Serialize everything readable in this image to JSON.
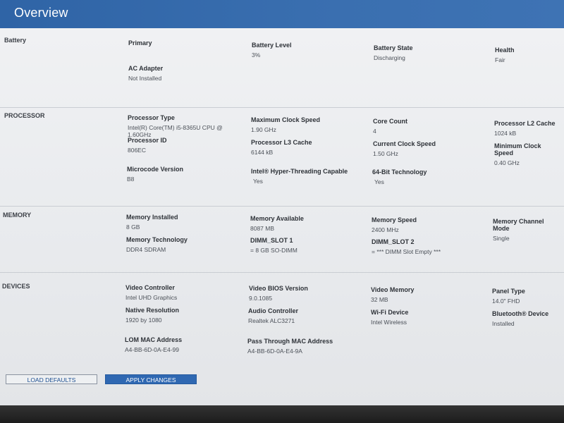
{
  "header": {
    "title": "Overview"
  },
  "sections": {
    "battery": {
      "title": "Battery",
      "fields": [
        {
          "label": "Primary",
          "value": ""
        },
        {
          "label": "Battery Level",
          "value": "3%"
        },
        {
          "label": "Battery State",
          "value": "Discharging"
        },
        {
          "label": "Health",
          "value": "Fair"
        },
        {
          "label": "AC Adapter",
          "value": "Not Installed"
        }
      ]
    },
    "processor": {
      "title": "PROCESSOR",
      "fields": [
        {
          "label": "Processor Type",
          "value": "Intel(R) Core(TM) i5-8365U CPU @ 1.60GHz"
        },
        {
          "label": "Maximum Clock Speed",
          "value": "1.90 GHz"
        },
        {
          "label": "Core Count",
          "value": "4"
        },
        {
          "label": "Processor L2 Cache",
          "value": "1024 kB"
        },
        {
          "label": "Processor ID",
          "value": "806EC"
        },
        {
          "label": "Processor L3 Cache",
          "value": "6144 kB"
        },
        {
          "label": "Current Clock Speed",
          "value": "1.50 GHz"
        },
        {
          "label": "Minimum Clock Speed",
          "value": "0.40 GHz"
        },
        {
          "label": "Microcode Version",
          "value": "B8"
        },
        {
          "label": "Intel® Hyper-Threading Capable",
          "value": "Yes"
        },
        {
          "label": "64-Bit Technology",
          "value": "Yes"
        }
      ]
    },
    "memory": {
      "title": "MEMORY",
      "fields": [
        {
          "label": "Memory Installed",
          "value": "8 GB"
        },
        {
          "label": "Memory Available",
          "value": "8087 MB"
        },
        {
          "label": "Memory Speed",
          "value": "2400 MHz"
        },
        {
          "label": "Memory Channel Mode",
          "value": "Single"
        },
        {
          "label": "Memory Technology",
          "value": "DDR4 SDRAM"
        },
        {
          "label": "DIMM_SLOT 1",
          "value": "= 8 GB SO-DIMM"
        },
        {
          "label": "DIMM_SLOT 2",
          "value": "= *** DIMM Slot Empty ***"
        }
      ]
    },
    "devices": {
      "title": "DEVICES",
      "fields": [
        {
          "label": "Video Controller",
          "value": "Intel UHD Graphics"
        },
        {
          "label": "Video BIOS Version",
          "value": "9.0.1085"
        },
        {
          "label": "Video Memory",
          "value": "32 MB"
        },
        {
          "label": "Panel Type",
          "value": "14.0\" FHD"
        },
        {
          "label": "Native Resolution",
          "value": "1920 by 1080"
        },
        {
          "label": "Audio Controller",
          "value": "Realtek ALC3271"
        },
        {
          "label": "Wi-Fi Device",
          "value": "Intel Wireless"
        },
        {
          "label": "Bluetooth® Device",
          "value": "Installed"
        },
        {
          "label": "LOM MAC Address",
          "value": "A4-BB-6D-0A-E4-99"
        },
        {
          "label": "Pass Through MAC Address",
          "value": "A4-BB-6D-0A-E4-9A"
        }
      ]
    }
  },
  "footer": {
    "load_defaults": "LOAD DEFAULTS",
    "apply_changes": "APPLY CHANGES"
  }
}
